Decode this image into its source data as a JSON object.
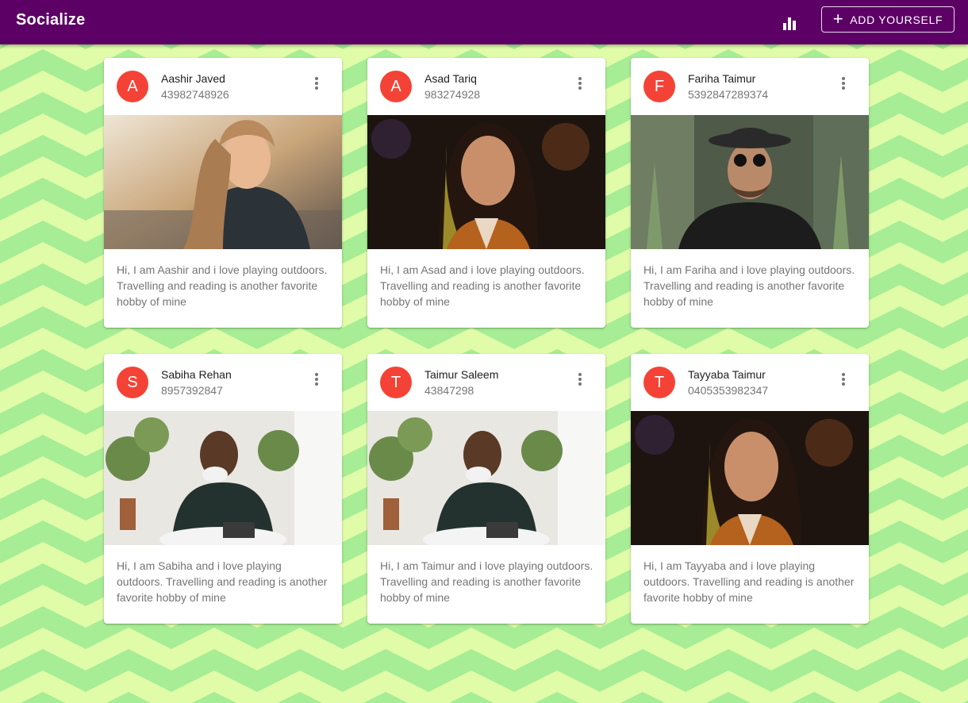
{
  "app": {
    "title": "Socialize",
    "add_button_label": "ADD YOURSELF"
  },
  "icons": {
    "stats": "bar-chart-icon",
    "add": "plus-icon",
    "card_menu": "more-vert-icon"
  },
  "colors": {
    "appbar": "#5d0066",
    "avatar": "#f44336",
    "background_light": "#e0fca8",
    "background_dark": "#a6ed95"
  },
  "cards": [
    {
      "initial": "A",
      "name": "Aashir Javed",
      "phone": "43982748926",
      "photo": "smiling woman with long hair outdoors",
      "bio": "Hi, I am Aashir and i love playing outdoors. Travelling and reading is another favorite hobby of mine"
    },
    {
      "initial": "A",
      "name": "Asad Tariq",
      "phone": "983274928",
      "photo": "woman with dark hair smiling at night",
      "bio": "Hi, I am Asad and i love playing outdoors. Travelling and reading is another favorite hobby of mine"
    },
    {
      "initial": "F",
      "name": "Fariha Taimur",
      "phone": "5392847289374",
      "photo": "bearded man in hat and sunglasses among cacti",
      "bio": "Hi, I am Fariha and i love playing outdoors. Travelling and reading is another favorite hobby of mine"
    },
    {
      "initial": "S",
      "name": "Sabiha Rehan",
      "phone": "8957392847",
      "photo": "man drinking coffee in a cafe with plants",
      "bio": "Hi, I am Sabiha and i love playing outdoors. Travelling and reading is another favorite hobby of mine"
    },
    {
      "initial": "T",
      "name": "Taimur Saleem",
      "phone": "43847298",
      "photo": "man drinking coffee in a cafe with plants",
      "bio": "Hi, I am Taimur and i love playing outdoors. Travelling and reading is another favorite hobby of mine"
    },
    {
      "initial": "T",
      "name": "Tayyaba Taimur",
      "phone": "0405353982347",
      "photo": "woman with dark hair smiling at night",
      "bio": "Hi, I am Tayyaba and i love playing outdoors. Travelling and reading is another favorite hobby of mine"
    }
  ]
}
